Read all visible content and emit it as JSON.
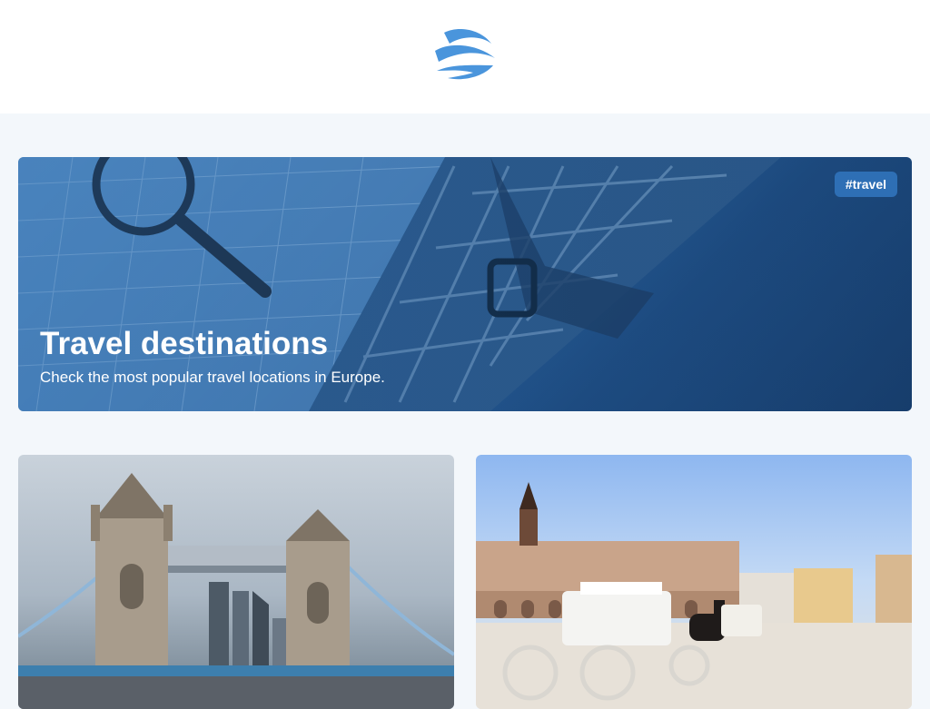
{
  "header": {
    "logo_icon": "wave-globe-logo-icon",
    "logo_color": "#4a95dc"
  },
  "hero": {
    "badge": "#travel",
    "title": "Travel destinations",
    "subtitle": "Check the most popular travel locations in Europe.",
    "image_icon": "map-magnifier-bag-photo"
  },
  "cards": [
    {
      "image_icon": "tower-bridge-london-photo"
    },
    {
      "image_icon": "krakow-main-square-carriage-photo"
    }
  ]
}
